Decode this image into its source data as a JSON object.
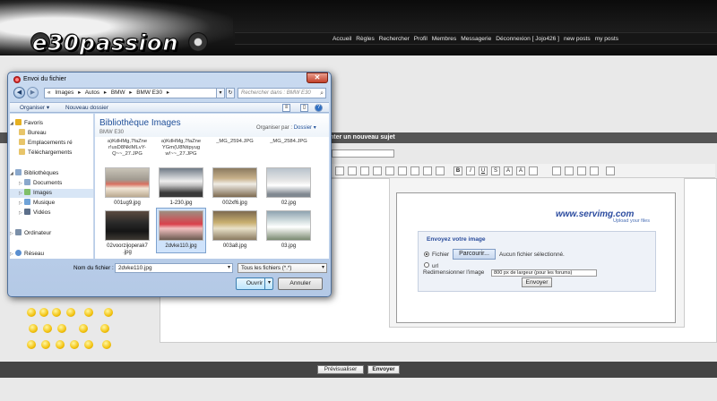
{
  "forum": {
    "logo": "e30passion",
    "nav": [
      "Accueil",
      "Règles",
      "Rechercher",
      "Profil",
      "Membres",
      "Messagerie",
      "Déconnexion [ Jojo426 ]",
      "new posts",
      "my posts"
    ],
    "topic_title": "nter un nouveau sujet",
    "footer": {
      "preview": "Prévisualiser",
      "send": "Envoyer"
    }
  },
  "servimg": {
    "logo": "www.servimg.com",
    "tagline": "Upload your files",
    "upload_title": "Envoyez votre image",
    "file_label": "Fichier",
    "browse": "Parcourir...",
    "no_file": "Aucun fichier sélectionné.",
    "url_label": "url",
    "resize_label": "Redimensionner l'image",
    "resize_value": "800 px de largeur (pour les forums)",
    "send": "Envoyer"
  },
  "dialog": {
    "title": "Envoi du fichier",
    "breadcrumb": [
      "«",
      "Images",
      "▸",
      "Autos",
      "▸",
      "BMW",
      "▸",
      "BMW E30",
      "▸"
    ],
    "search_placeholder": "Rechercher dans : BMW E30",
    "cmd": {
      "organize": "Organiser ▾",
      "new_folder": "Nouveau dossier"
    },
    "nav": {
      "favorites": "Favoris",
      "desktop": "Bureau",
      "recent": "Emplacements ré",
      "downloads": "Téléchargements",
      "libraries": "Bibliothèques",
      "documents": "Documents",
      "images": "Images",
      "music": "Musique",
      "videos": "Vidéos",
      "computer": "Ordinateur",
      "network": "Réseau"
    },
    "library": {
      "title": "Bibliothèque Images",
      "subtitle": "BMW E30",
      "arrange_label": "Organiser par :",
      "arrange_value": "Dossier ▾"
    },
    "cut_names": [
      [
        "a)KdHMg,7faZne",
        "r!usD8NkIMLvY-",
        "Q~~_27.JPG"
      ],
      [
        "a)KdHMg,7faZne",
        "YGm(U8Ntipyug",
        "w!~~_27.JPG"
      ],
      [
        "_MG_2594.JPG"
      ],
      [
        "_MG_2584.JPG"
      ]
    ],
    "files": [
      [
        "001ug9.jpg"
      ],
      [
        "1-230.jpg"
      ],
      [
        "002xf6.jpg"
      ],
      [
        "02.jpg"
      ],
      [
        "02voorzijoperak7",
        ".jpg"
      ],
      [
        "2dvke110.jpg"
      ],
      [
        "003a8.jpg"
      ],
      [
        "03.jpg"
      ]
    ],
    "filename_label": "Nom du fichier :",
    "filename_value": "2dvke110.jpg",
    "filter_value": "Tous les fichiers (*.*)",
    "open": "Ouvrir",
    "cancel": "Annuler"
  }
}
